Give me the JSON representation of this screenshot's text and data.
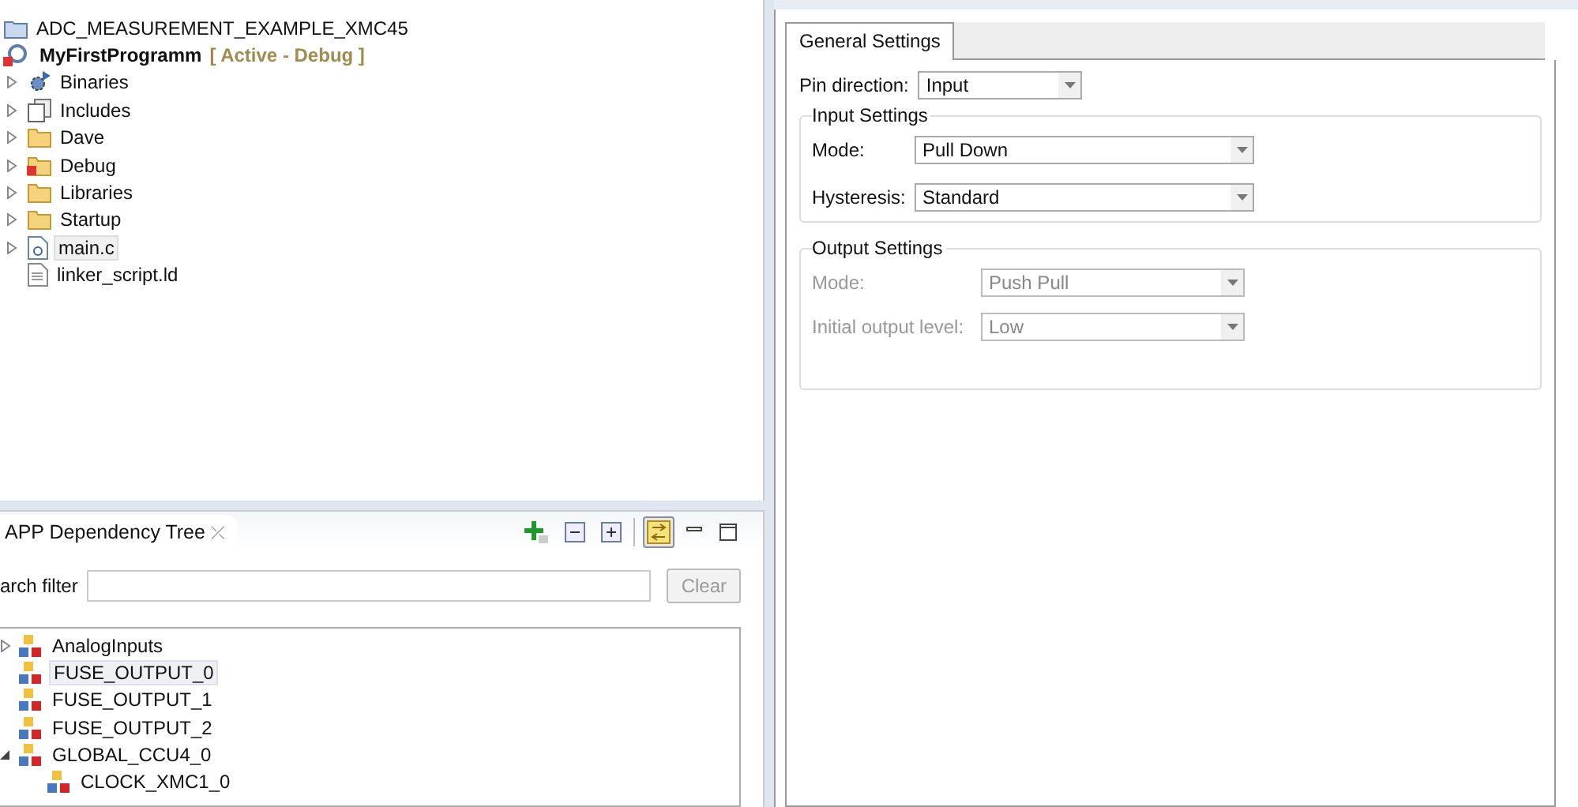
{
  "project_tree": [
    {
      "label": "ADC_MEASUREMENT_EXAMPLE_XMC45",
      "kind": "project",
      "selected": false
    },
    {
      "label": "MyFirstProgramm",
      "status": "[ Active - Debug ]",
      "kind": "active-project",
      "selected": false,
      "children": [
        {
          "label": "Binaries",
          "kind": "binaries",
          "expanded": false,
          "selected": false
        },
        {
          "label": "Includes",
          "kind": "includes",
          "expanded": false,
          "selected": false
        },
        {
          "label": "Dave",
          "kind": "folder",
          "expanded": false,
          "selected": false
        },
        {
          "label": "Debug",
          "kind": "debug-folder",
          "expanded": false,
          "selected": false
        },
        {
          "label": "Libraries",
          "kind": "folder",
          "expanded": false,
          "selected": false
        },
        {
          "label": "Startup",
          "kind": "folder",
          "expanded": false,
          "selected": false
        },
        {
          "label": "main.c",
          "kind": "c-file",
          "expanded": false,
          "selected": true
        },
        {
          "label": "linker_script.ld",
          "kind": "text-file",
          "selected": false
        }
      ]
    }
  ],
  "dependency_view": {
    "tab": {
      "title": "APP Dependency Tree",
      "close": "⤫"
    },
    "toolbar": [
      {
        "kind": "add",
        "pressed": false
      },
      {
        "kind": "collapse",
        "pressed": false
      },
      {
        "kind": "expand",
        "pressed": false
      },
      {
        "kind": "link",
        "pressed": true
      },
      {
        "kind": "minimize",
        "pressed": false
      },
      {
        "kind": "maximize",
        "pressed": false
      }
    ],
    "filter_label": "arch filter",
    "clear_button": "Clear",
    "tree": [
      {
        "label": "AnalogInputs",
        "expanded": false,
        "selected": false
      },
      {
        "label": "FUSE_OUTPUT_0",
        "selected": true
      },
      {
        "label": "FUSE_OUTPUT_1",
        "selected": false
      },
      {
        "label": "FUSE_OUTPUT_2",
        "selected": false
      },
      {
        "label": "GLOBAL_CCU4_0",
        "expanded": true,
        "selected": false,
        "children": [
          {
            "label": "CLOCK_XMC1_0",
            "selected": false
          }
        ]
      }
    ]
  },
  "settings": {
    "tabs": [
      {
        "label": "General Settings",
        "selected": true
      }
    ],
    "pin_direction": {
      "label": "Pin direction:",
      "value": "Input"
    },
    "groups": [
      {
        "title": "Input Settings",
        "disabled": false,
        "fields": [
          {
            "label": "Mode:",
            "value": "Pull Down"
          },
          {
            "label": "Hysteresis:",
            "value": "Standard"
          }
        ]
      },
      {
        "title": "Output Settings",
        "disabled": true,
        "fields": [
          {
            "label": "Mode:",
            "value": "Push Pull"
          },
          {
            "label": "Initial output level:",
            "value": "Low"
          }
        ]
      }
    ]
  }
}
